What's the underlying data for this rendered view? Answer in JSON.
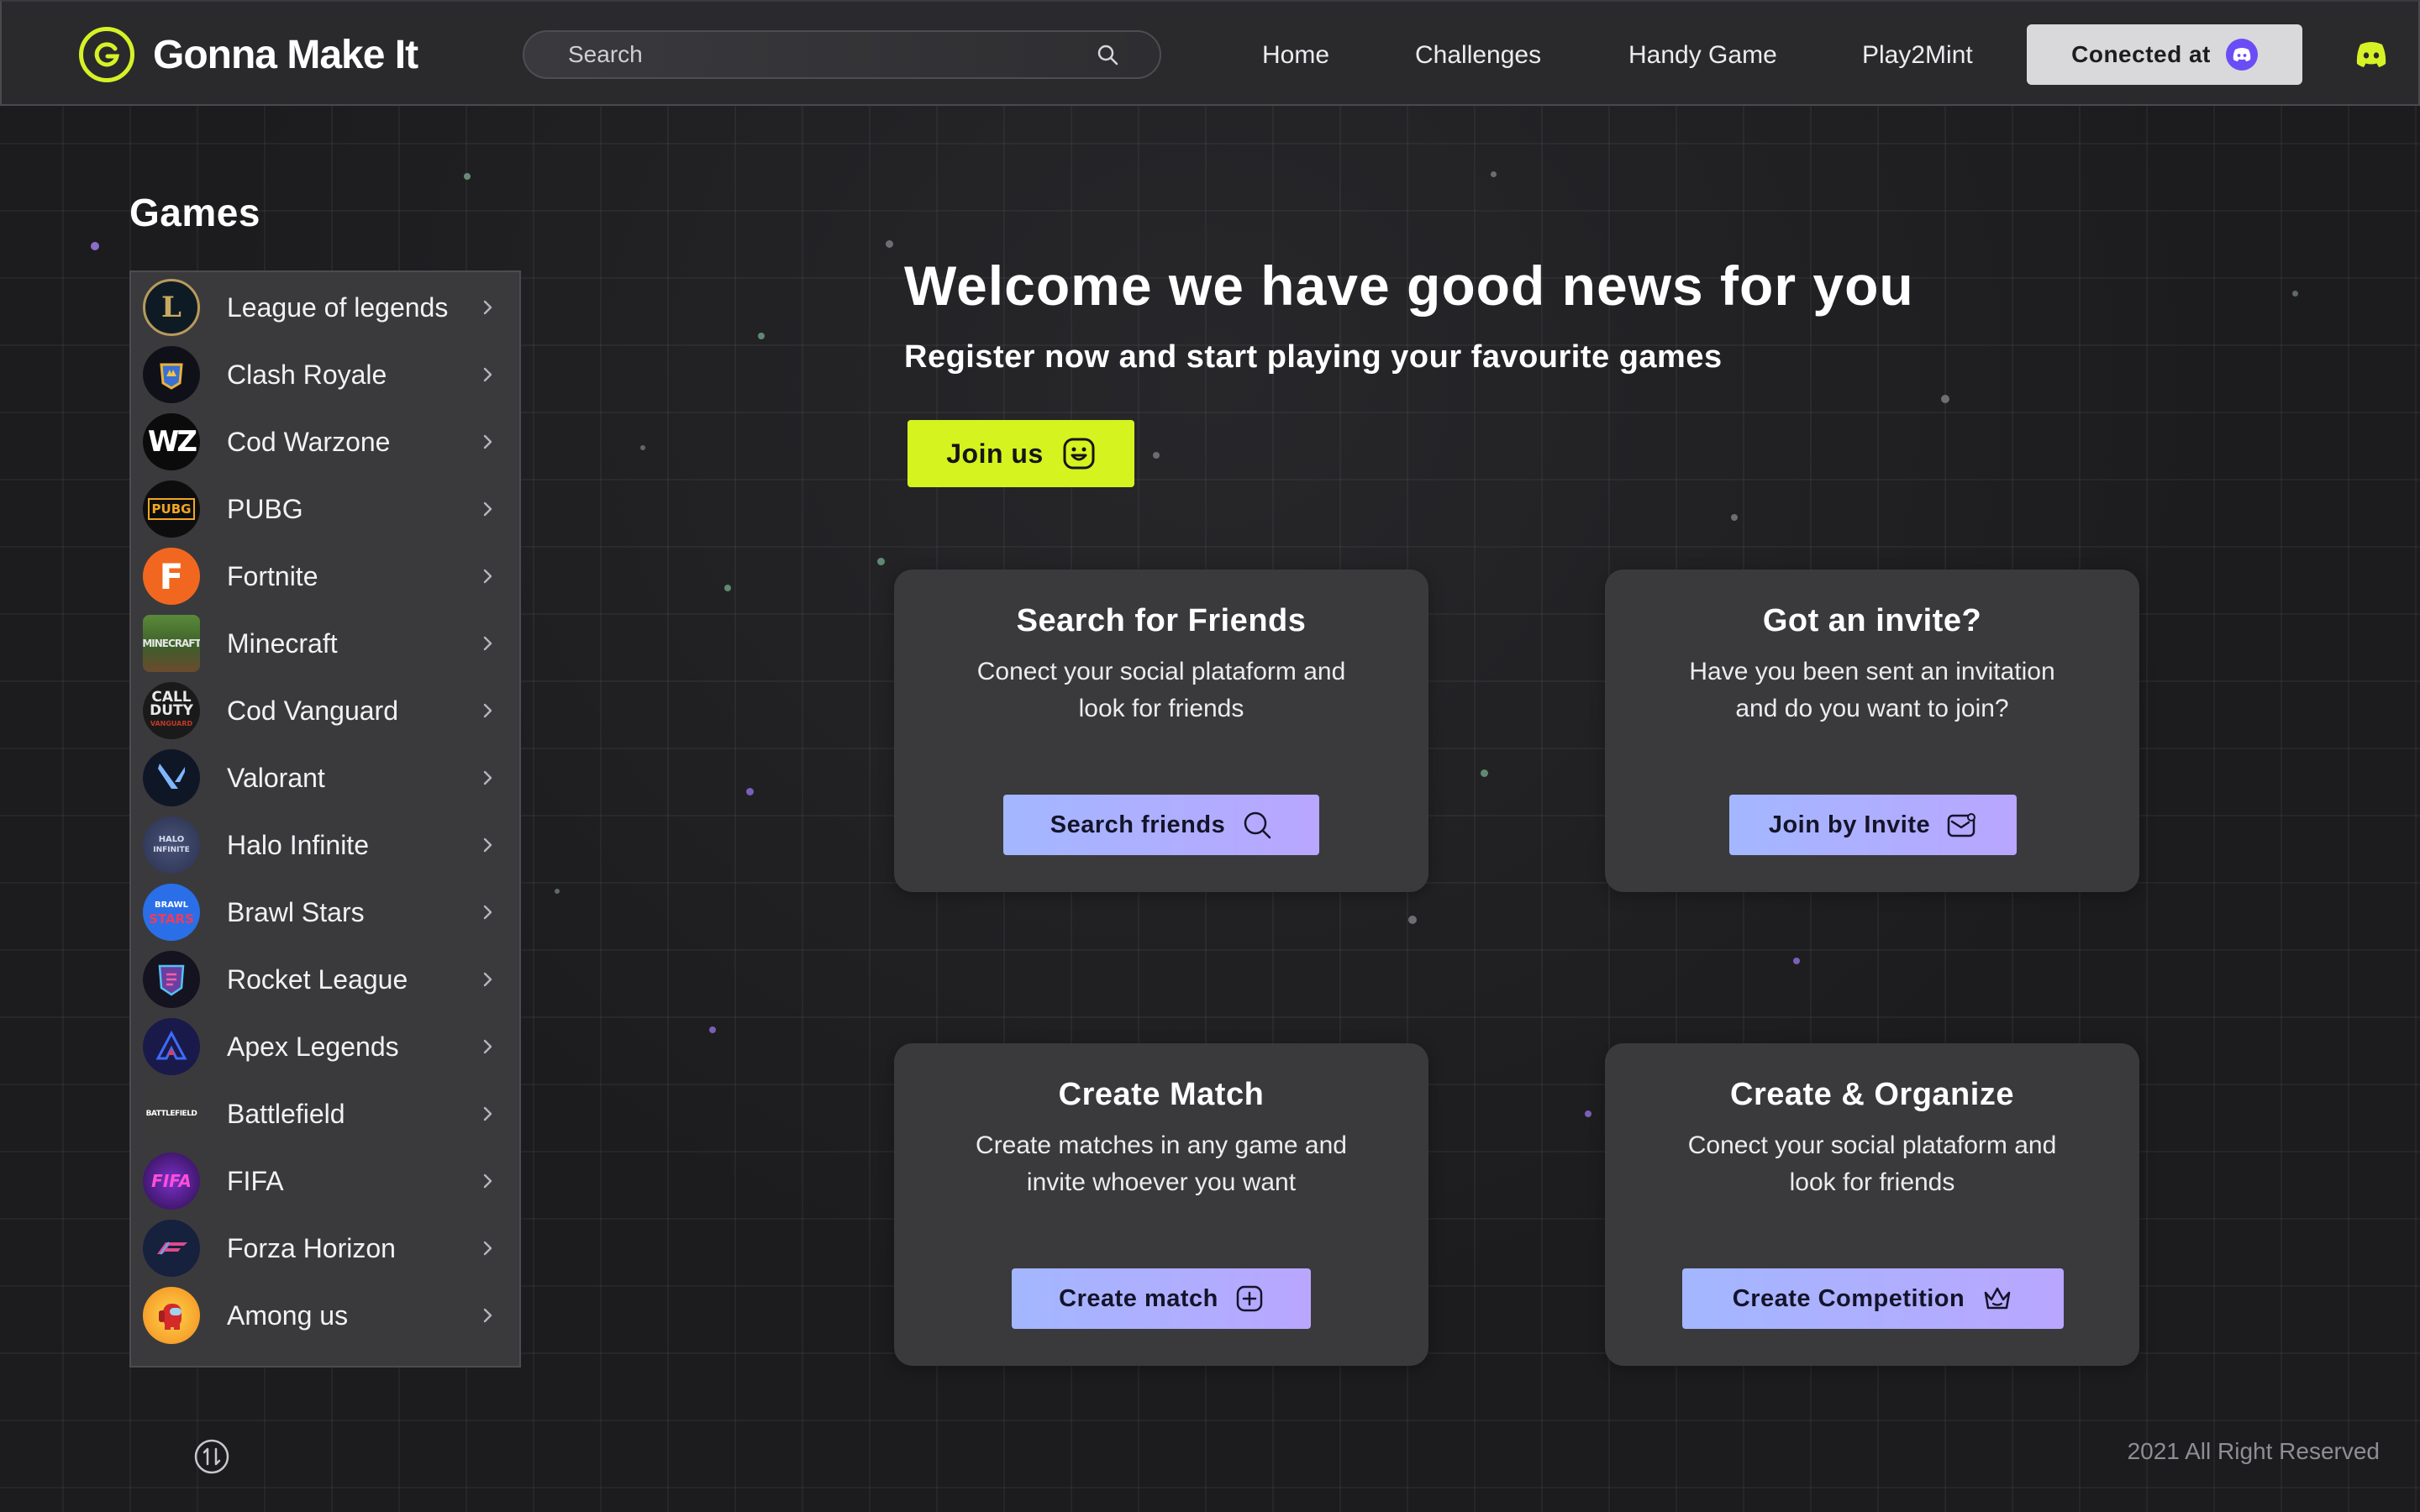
{
  "brand": {
    "name": "Gonna Make It",
    "accent": "#d6f227"
  },
  "search": {
    "placeholder": "Search",
    "value": ""
  },
  "nav": {
    "items": [
      {
        "label": "Home"
      },
      {
        "label": "Challenges"
      },
      {
        "label": "Handy Game"
      },
      {
        "label": "Play2Mint"
      }
    ],
    "connected_label": "Conected at",
    "connected_icon": "discord-icon",
    "discord_color": "#d6f227"
  },
  "sidebar": {
    "title": "Games",
    "games": [
      {
        "name": "League of legends",
        "icon": "league-of-legends-logo"
      },
      {
        "name": "Clash Royale",
        "icon": "clash-royale-logo"
      },
      {
        "name": "Cod Warzone",
        "icon": "cod-warzone-logo"
      },
      {
        "name": "PUBG",
        "icon": "pubg-logo"
      },
      {
        "name": "Fortnite",
        "icon": "fortnite-logo"
      },
      {
        "name": "Minecraft",
        "icon": "minecraft-logo"
      },
      {
        "name": "Cod Vanguard",
        "icon": "cod-vanguard-logo"
      },
      {
        "name": "Valorant",
        "icon": "valorant-logo"
      },
      {
        "name": "Halo Infinite",
        "icon": "halo-infinite-logo"
      },
      {
        "name": "Brawl Stars",
        "icon": "brawl-stars-logo"
      },
      {
        "name": "Rocket League",
        "icon": "rocket-league-logo"
      },
      {
        "name": "Apex Legends",
        "icon": "apex-legends-logo"
      },
      {
        "name": "Battlefield",
        "icon": "battlefield-logo"
      },
      {
        "name": "FIFA",
        "icon": "fifa-logo"
      },
      {
        "name": "Forza Horizon",
        "icon": "forza-horizon-logo"
      },
      {
        "name": "Among us",
        "icon": "among-us-logo"
      }
    ]
  },
  "hero": {
    "title": "Welcome we have good news for you",
    "subtitle": "Register now and start playing your favourite games",
    "join_label": "Join us",
    "join_color": "#d4f31f"
  },
  "cards": [
    {
      "title": "Search for Friends",
      "desc_line1": "Conect your social plataform and",
      "desc_line2": "look for friends",
      "button": "Search friends",
      "button_icon": "search-icon"
    },
    {
      "title": "Got an invite?",
      "desc_line1": "Have you been sent an invitation",
      "desc_line2": "and do you want to join?",
      "button": "Join by Invite",
      "button_icon": "mail-icon"
    },
    {
      "title": "Create Match",
      "desc_line1": "Create matches in any game and",
      "desc_line2": "invite whoever you want",
      "button": "Create match",
      "button_icon": "plus-square-icon"
    },
    {
      "title": "Create & Organize",
      "desc_line1": "Conect your social plataform and",
      "desc_line2": "look for friends",
      "button": "Create Competition",
      "button_icon": "crown-icon"
    }
  ],
  "footer": {
    "copyright": "2021 All Right Reserved"
  },
  "colors": {
    "button_gradient": [
      "#a3b7ff",
      "#b9a6ff"
    ],
    "panel": "#3a3a3d"
  }
}
